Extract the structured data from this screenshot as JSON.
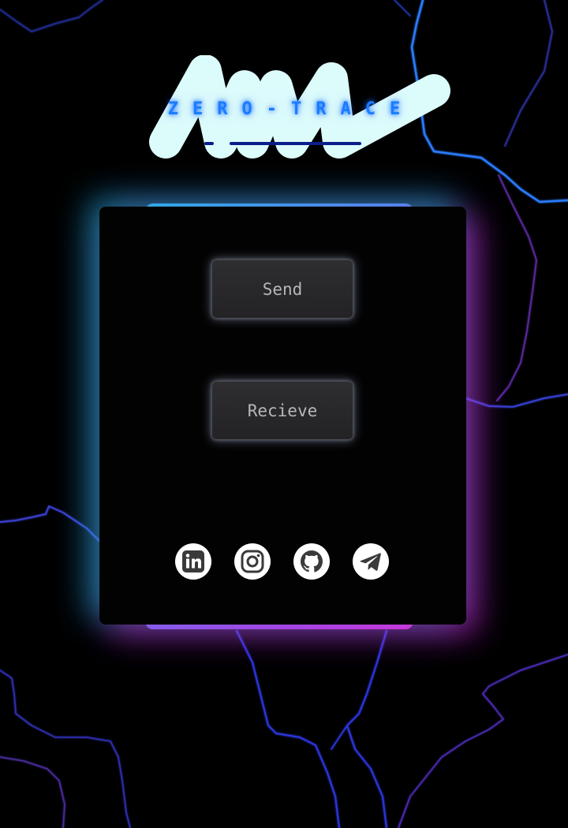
{
  "brand": {
    "title": "ZERO-TRACE",
    "title_color": "#1a7cff",
    "logo_color": "#dcfbfb"
  },
  "actions": {
    "send_label": "Send",
    "receive_label": "Recieve"
  },
  "social": [
    {
      "icon": "linkedin-icon",
      "label": "LinkedIn"
    },
    {
      "icon": "instagram-icon",
      "label": "Instagram"
    },
    {
      "icon": "github-icon",
      "label": "GitHub"
    },
    {
      "icon": "telegram-icon",
      "label": "Telegram"
    }
  ],
  "colors": {
    "card_gradient_start": "#22c3f0",
    "card_gradient_mid": "#6a76ff",
    "card_gradient_end": "#ff1fd6",
    "background_lines": "#2a3cff"
  }
}
